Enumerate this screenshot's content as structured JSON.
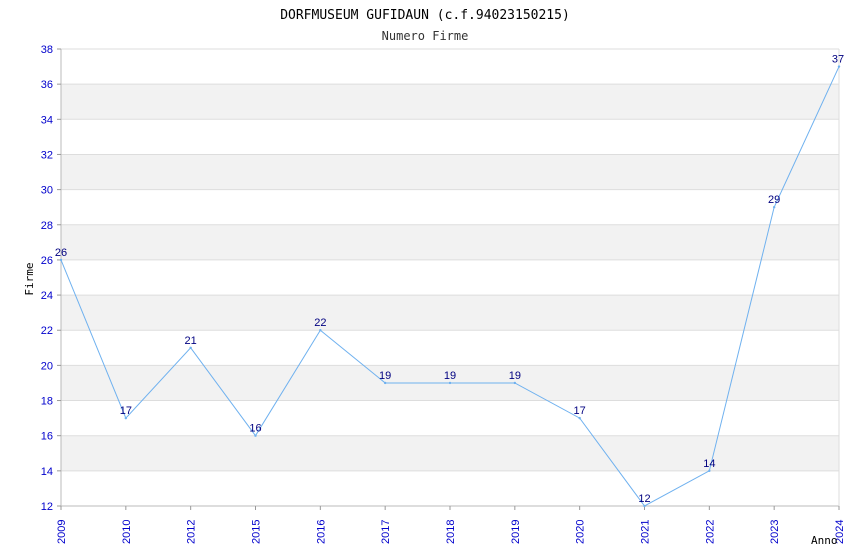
{
  "colors": {
    "line": "#6fb1ef",
    "band": "#f2f2f2",
    "grid": "#dddddd",
    "tick_text": "#0000cc",
    "data_label_text": "#000080"
  },
  "chart_data": {
    "type": "line",
    "title": "DORFMUSEUM GUFIDAUN (c.f.94023150215)",
    "subtitle": "Numero Firme",
    "xlabel": "Anno",
    "ylabel": "Firme",
    "categories": [
      "2009",
      "2010",
      "2012",
      "2015",
      "2016",
      "2017",
      "2018",
      "2019",
      "2020",
      "2021",
      "2022",
      "2023",
      "2024"
    ],
    "series": [
      {
        "values": [
          26,
          17,
          21,
          16,
          22,
          19,
          19,
          19,
          17,
          12,
          14,
          29,
          37
        ]
      }
    ],
    "ylim": [
      12,
      38
    ],
    "yticks": [
      12,
      14,
      16,
      18,
      20,
      22,
      24,
      26,
      28,
      30,
      32,
      34,
      36,
      38
    ],
    "grid": true,
    "legend": "none"
  }
}
